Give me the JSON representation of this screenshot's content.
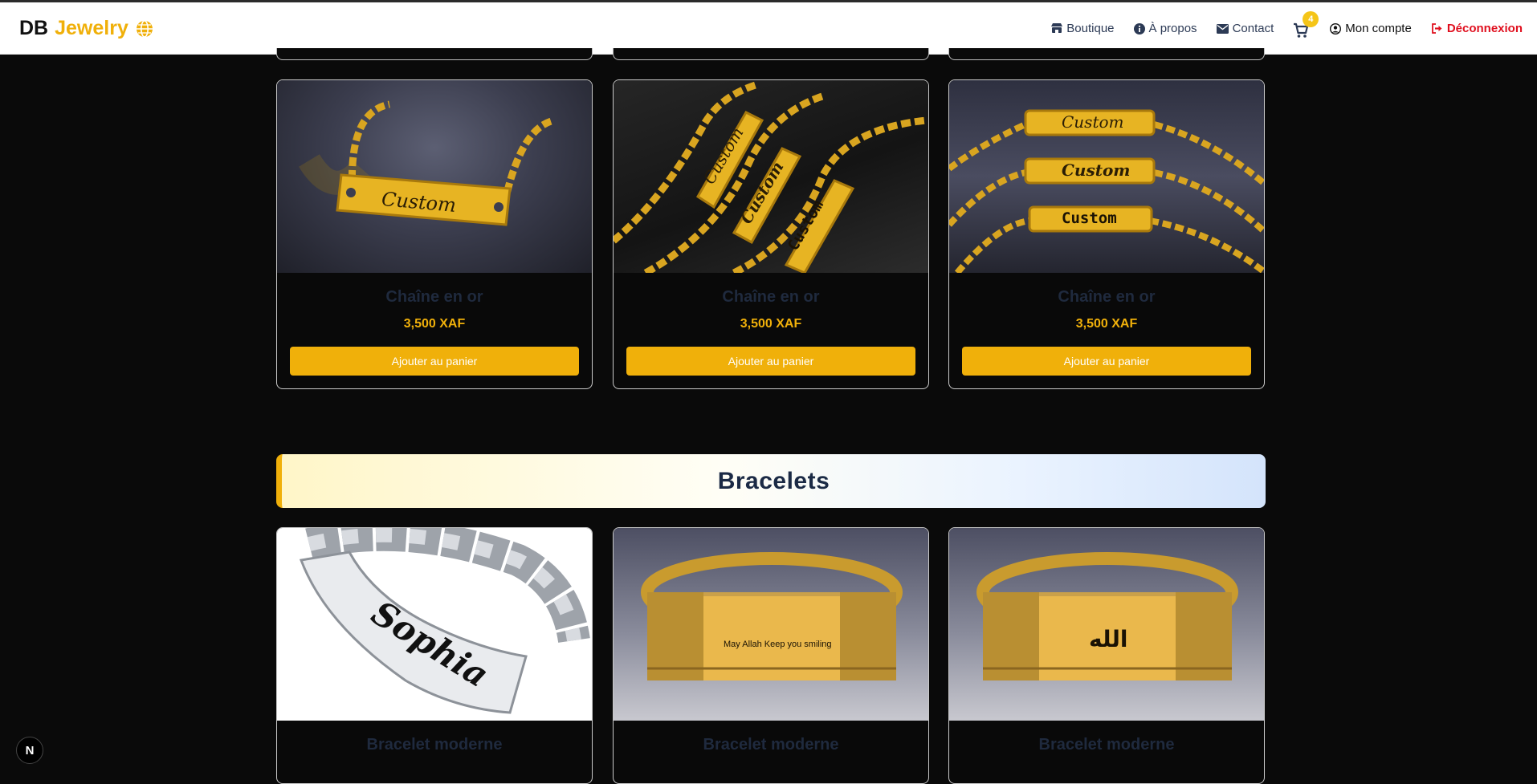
{
  "brand": {
    "name": "DB",
    "accent": "Jewelry",
    "icon": "globe-icon"
  },
  "nav": {
    "shop": "Boutique",
    "about": "À propos",
    "contact": "Contact",
    "cart_count": "4",
    "account": "Mon compte",
    "logout": "Déconnexion"
  },
  "chains": [
    {
      "name": "Chaîne en or",
      "price": "3,500 XAF",
      "button": "Ajouter au panier",
      "engraving": "Custom"
    },
    {
      "name": "Chaîne en or",
      "price": "3,500 XAF",
      "button": "Ajouter au panier",
      "engraving": "Custom"
    },
    {
      "name": "Chaîne en or",
      "price": "3,500 XAF",
      "button": "Ajouter au panier",
      "engraving": "Custom"
    }
  ],
  "bracelets_section": {
    "title": "Bracelets"
  },
  "bracelets": [
    {
      "name": "Bracelet moderne",
      "engraving": "Sophia"
    },
    {
      "name": "Bracelet moderne",
      "engraving": "May Allah Keep you smiling"
    },
    {
      "name": "Bracelet moderne",
      "engraving": "الله"
    }
  ],
  "dev_badge": "N",
  "colors": {
    "accent": "#f0b00a",
    "logout": "#e0101f",
    "background": "#0a0a0a"
  }
}
